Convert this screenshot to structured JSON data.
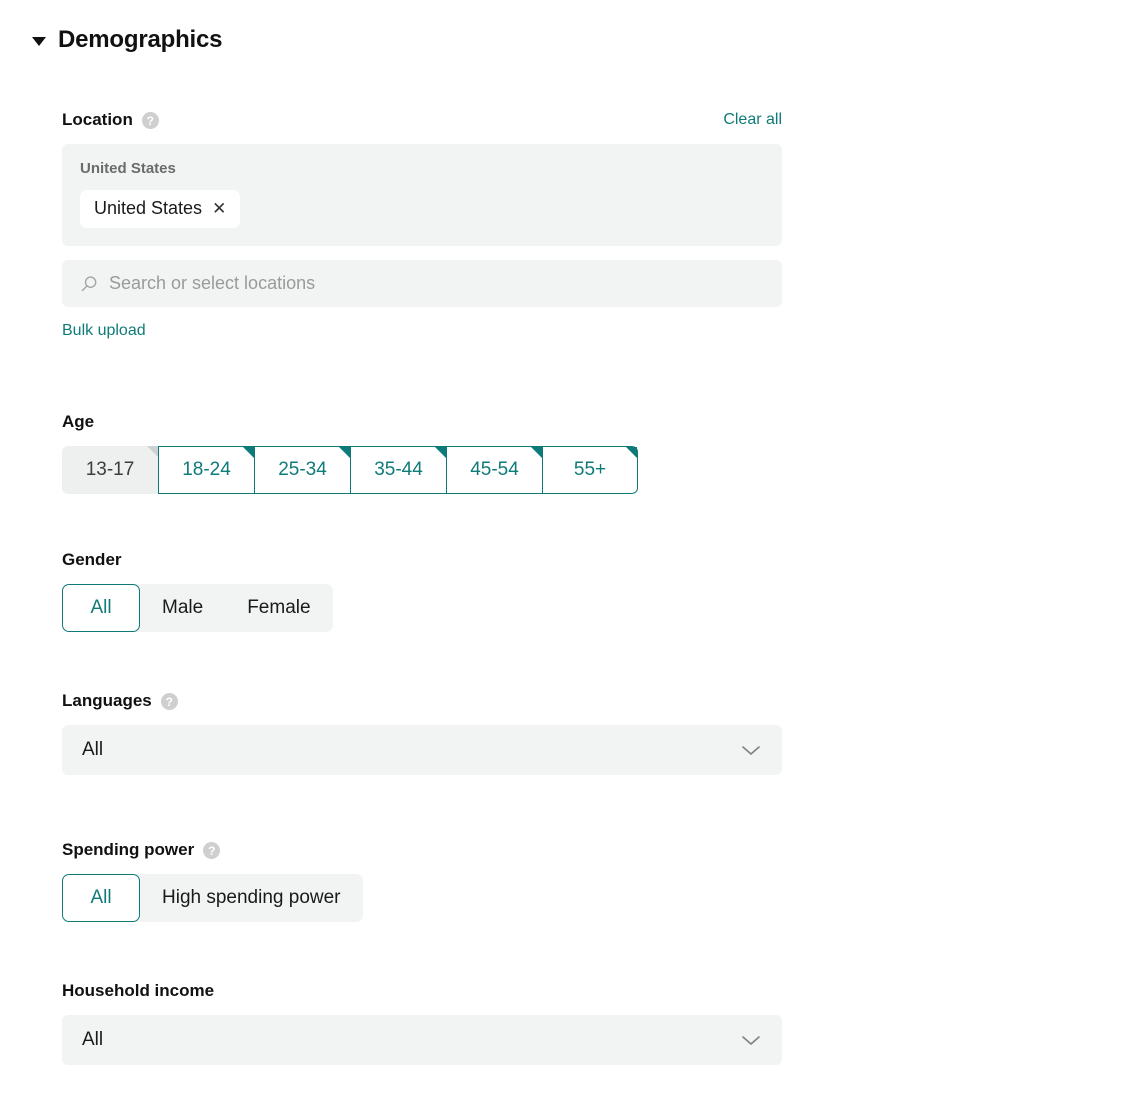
{
  "section": {
    "title": "Demographics",
    "collapse_icon": "caret-down-icon"
  },
  "location": {
    "label": "Location",
    "help_icon": "help-circle-icon",
    "clear_all_label": "Clear all",
    "group_title": "United States",
    "chips": [
      {
        "label": "United States",
        "remove_icon": "close-icon"
      }
    ],
    "search_placeholder": "Search or select locations",
    "search_icon": "search-icon",
    "bulk_upload_label": "Bulk upload"
  },
  "age": {
    "label": "Age",
    "options": [
      {
        "label": "13-17",
        "state": "disabled"
      },
      {
        "label": "18-24",
        "state": "selected"
      },
      {
        "label": "25-34",
        "state": "selected"
      },
      {
        "label": "35-44",
        "state": "selected"
      },
      {
        "label": "45-54",
        "state": "selected"
      },
      {
        "label": "55+",
        "state": "selected"
      }
    ]
  },
  "gender": {
    "label": "Gender",
    "options": [
      "All",
      "Male",
      "Female"
    ],
    "selected": "All"
  },
  "languages": {
    "label": "Languages",
    "help_icon": "help-circle-icon",
    "value": "All",
    "chevron_icon": "chevron-down-icon"
  },
  "spending_power": {
    "label": "Spending power",
    "help_icon": "help-circle-icon",
    "options": [
      "All",
      "High spending power"
    ],
    "selected": "All"
  },
  "household_income": {
    "label": "Household income",
    "value": "All",
    "chevron_icon": "chevron-down-icon"
  },
  "colors": {
    "accent": "#0f7b78",
    "field_background": "#f2f3f3",
    "text": "#1a1a1a",
    "muted_text": "#6b6b6b",
    "placeholder": "#9a9a9a",
    "disabled_background": "#eef0f0",
    "disabled_corner": "#cdd1d1"
  }
}
